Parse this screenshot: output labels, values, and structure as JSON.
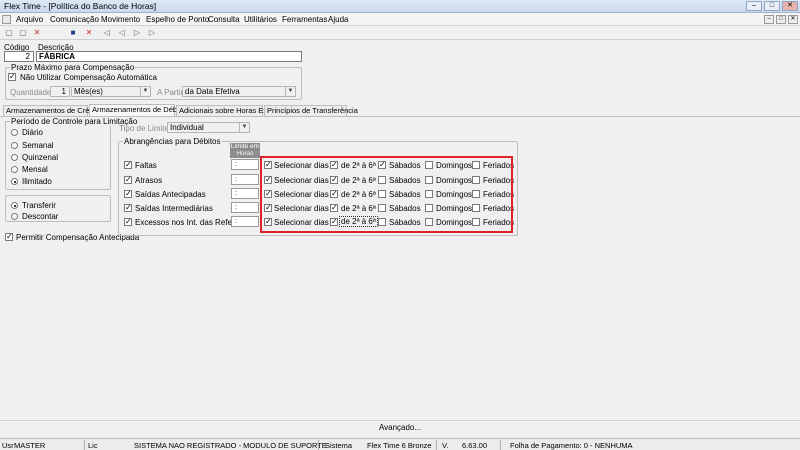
{
  "window": {
    "title": "Flex Time - [Política do Banco de Horas]",
    "btn_min": "–",
    "btn_max": "□",
    "btn_close": "✕"
  },
  "menu": [
    "Arquivo",
    "Comunicação",
    "Movimento",
    "Espelho de Ponto",
    "Consulta",
    "Utilitários",
    "Ferramentas",
    "Ajuda"
  ],
  "toolbar": {
    "new": "▢",
    "copy": "▢",
    "delete": "✕",
    "save": "■",
    "first": "◁",
    "prev": "◁",
    "next": "▷",
    "last": "▷"
  },
  "header": {
    "codigo_label": "Código",
    "codigo_value": "2",
    "descricao_label": "Descrição",
    "descricao_value": "FÁBRICA"
  },
  "prazo": {
    "title": "Prazo Máximo para Compensação",
    "nao_utilizar": "Não Utilizar Compensação Automática",
    "quantidade_label": "Quantidade",
    "quantidade_value": "1",
    "unidade_value": "Mês(es)",
    "apartir_label": "A Partir",
    "apartir_value": "da Data Efetiva"
  },
  "tabs": [
    "Armazenamentos de Créditos",
    "Armazenamentos de Débitos",
    "Adicionais sobre Horas Extras",
    "Princípios de Transferência"
  ],
  "periodo": {
    "title": "Período de Controle para Limitação",
    "options": [
      "Diário",
      "Semanal",
      "Quinzenal",
      "Mensal",
      "Ilimitado"
    ],
    "selected": "Ilimitado"
  },
  "acao": {
    "options": [
      "Transferir",
      "Descontar"
    ],
    "selected": "Transferir"
  },
  "permitir": "Permitir Compensação Antecipada",
  "tipo_limite": {
    "label": "Tipo de Limite",
    "value": "Individual"
  },
  "abrangencias": {
    "title": "Abrangências para Débitos",
    "limite_header_1": "Limite em",
    "limite_header_2": "Horas",
    "time_placeholder": ":",
    "rows": [
      {
        "label": "Faltas",
        "sabados": true
      },
      {
        "label": "Atrasos",
        "sabados": false
      },
      {
        "label": "Saídas Antecipadas",
        "sabados": false
      },
      {
        "label": "Saídas Intermediárias",
        "sabados": false
      },
      {
        "label": "Excessos nos Int. das Refeições",
        "sabados": false
      }
    ],
    "col_selecionar": "Selecionar dias",
    "col_semana": "de 2ª à 6ª",
    "col_sabados": "Sábados",
    "col_domingos": "Domingos",
    "col_feriados": "Feriados"
  },
  "avancado": "Avançado...",
  "status": {
    "usr_label": "Usr",
    "usr_value": "MASTER",
    "lic_label": "Lic",
    "lic_value": "SISTEMA NAO REGISTRADO - MODULO DE SUPORTE",
    "sistema_label": "Sistema",
    "sistema_value": "Flex Time 6 Bronze",
    "versao_label": "V.",
    "versao_value": "6.63.00",
    "folha": "Folha de Pagamento: 0 - NENHUMA"
  },
  "colors": {
    "highlight": "#e0202a",
    "limit_header": "#8c8c8c"
  }
}
